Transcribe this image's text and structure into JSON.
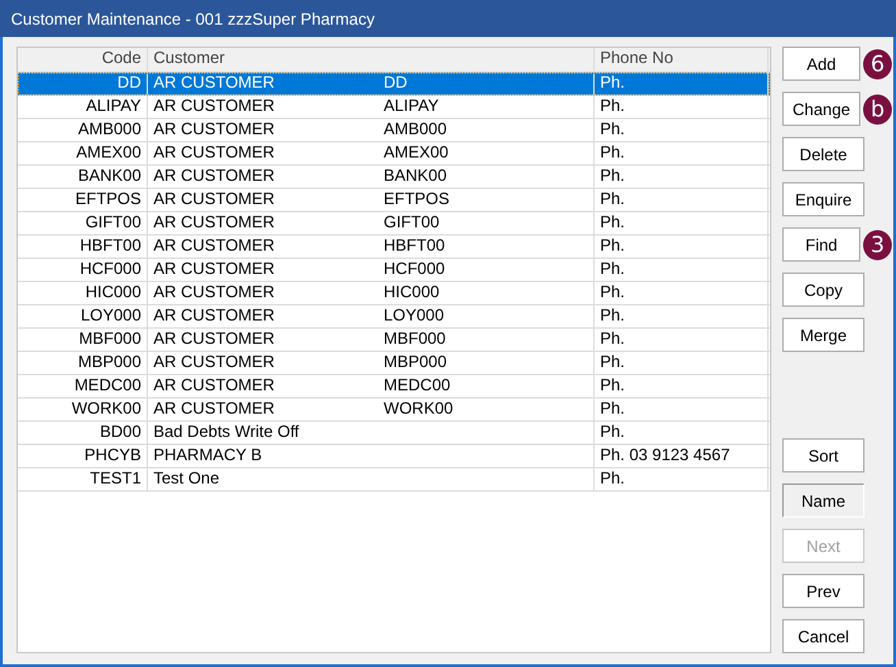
{
  "window": {
    "title": "Customer Maintenance - 001 zzzSuper Pharmacy"
  },
  "table": {
    "columns": [
      "Code",
      "Customer",
      "Phone No"
    ],
    "rows": [
      {
        "code": "DD",
        "customer": "AR CUSTOMER\tDD",
        "phone": "Ph.",
        "selected": true
      },
      {
        "code": "ALIPAY",
        "customer": "AR CUSTOMER\tALIPAY",
        "phone": "Ph.",
        "selected": false
      },
      {
        "code": "AMB000",
        "customer": "AR CUSTOMER\tAMB000",
        "phone": "Ph.",
        "selected": false
      },
      {
        "code": "AMEX00",
        "customer": "AR CUSTOMER\tAMEX00",
        "phone": "Ph.",
        "selected": false
      },
      {
        "code": "BANK00",
        "customer": "AR CUSTOMER\tBANK00",
        "phone": "Ph.",
        "selected": false
      },
      {
        "code": "EFTPOS",
        "customer": "AR CUSTOMER\tEFTPOS",
        "phone": "Ph.",
        "selected": false
      },
      {
        "code": "GIFT00",
        "customer": "AR CUSTOMER\tGIFT00",
        "phone": "Ph.",
        "selected": false
      },
      {
        "code": "HBFT00",
        "customer": "AR CUSTOMER\tHBFT00",
        "phone": "Ph.",
        "selected": false
      },
      {
        "code": "HCF000",
        "customer": "AR CUSTOMER\tHCF000",
        "phone": "Ph.",
        "selected": false
      },
      {
        "code": "HIC000",
        "customer": "AR CUSTOMER\tHIC000",
        "phone": "Ph.",
        "selected": false
      },
      {
        "code": "LOY000",
        "customer": "AR CUSTOMER\tLOY000",
        "phone": "Ph.",
        "selected": false
      },
      {
        "code": "MBF000",
        "customer": "AR CUSTOMER\tMBF000",
        "phone": "Ph.",
        "selected": false
      },
      {
        "code": "MBP000",
        "customer": "AR CUSTOMER\tMBP000",
        "phone": "Ph.",
        "selected": false
      },
      {
        "code": "MEDC00",
        "customer": "AR CUSTOMER\tMEDC00",
        "phone": "Ph.",
        "selected": false
      },
      {
        "code": "WORK00",
        "customer": "AR CUSTOMER\tWORK00",
        "phone": "Ph.",
        "selected": false
      },
      {
        "code": "BD00",
        "customer": "Bad Debts Write Off",
        "phone": "Ph.",
        "selected": false
      },
      {
        "code": "PHCYB",
        "customer": "PHARMACY B",
        "phone": "Ph. 03 9123 4567",
        "selected": false
      },
      {
        "code": "TEST1",
        "customer": "Test One",
        "phone": "Ph.",
        "selected": false
      }
    ]
  },
  "buttons_top": [
    {
      "label": "Add",
      "badge": "6"
    },
    {
      "label": "Change",
      "badge": "b"
    },
    {
      "label": "Delete"
    },
    {
      "label": "Enquire"
    },
    {
      "label": "Find",
      "badge": "3"
    },
    {
      "label": "Copy"
    },
    {
      "label": "Merge"
    }
  ],
  "buttons_bottom": [
    {
      "label": "Sort",
      "pressed": false,
      "disabled": false
    },
    {
      "label": "Name",
      "pressed": true,
      "disabled": false
    },
    {
      "label": "Next",
      "pressed": false,
      "disabled": true
    },
    {
      "label": "Prev",
      "pressed": false,
      "disabled": false
    },
    {
      "label": "Cancel",
      "pressed": false,
      "disabled": false
    }
  ]
}
